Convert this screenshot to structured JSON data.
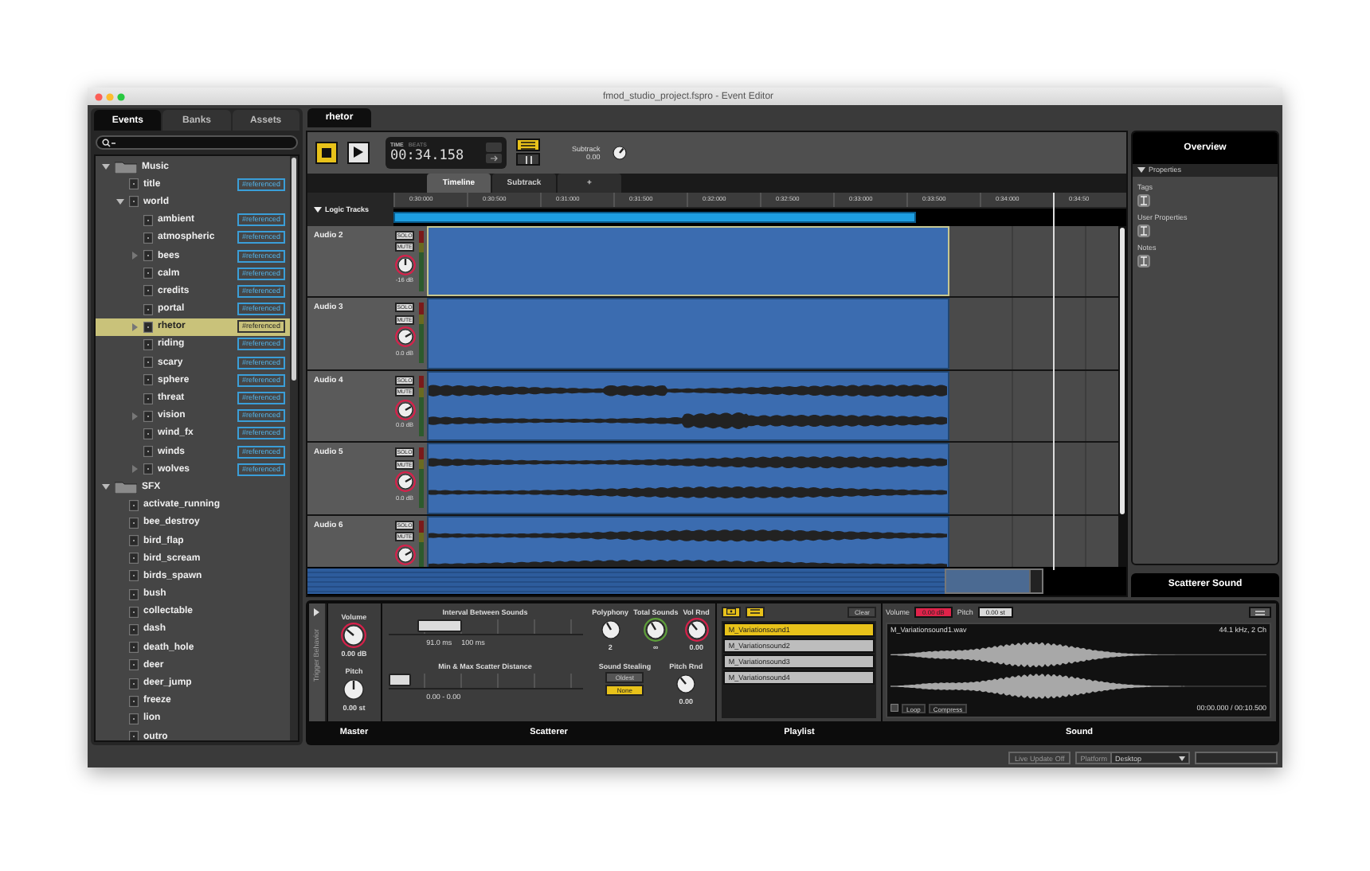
{
  "window": {
    "title": "fmod_studio_project.fspro - Event Editor"
  },
  "browser": {
    "tabs": [
      {
        "label": "Events",
        "selected": true
      },
      {
        "label": "Banks",
        "selected": false
      },
      {
        "label": "Assets",
        "selected": false
      }
    ],
    "tree": [
      {
        "label": "Music",
        "kind": "folder",
        "expanded": true,
        "selected": false,
        "children": [
          {
            "label": "title",
            "kind": "event",
            "badge": "#referenced",
            "selected": false
          },
          {
            "label": "world",
            "kind": "event",
            "expanded": true,
            "selected": false,
            "children": [
              {
                "label": "ambient",
                "kind": "event",
                "badge": "#referenced",
                "selected": false
              },
              {
                "label": "atmospheric",
                "kind": "event",
                "badge": "#referenced",
                "selected": false
              },
              {
                "label": "bees",
                "kind": "event",
                "expanded": false,
                "badge": "#referenced",
                "selected": false
              },
              {
                "label": "calm",
                "kind": "event",
                "badge": "#referenced",
                "selected": false
              },
              {
                "label": "credits",
                "kind": "event",
                "badge": "#referenced",
                "selected": false
              },
              {
                "label": "portal",
                "kind": "event",
                "badge": "#referenced",
                "selected": false
              },
              {
                "label": "rhetor",
                "kind": "event",
                "expanded": false,
                "badge": "#referenced",
                "selected": true
              },
              {
                "label": "riding",
                "kind": "event",
                "badge": "#referenced",
                "selected": false
              },
              {
                "label": "scary",
                "kind": "event",
                "badge": "#referenced",
                "selected": false
              },
              {
                "label": "sphere",
                "kind": "event",
                "badge": "#referenced",
                "selected": false
              },
              {
                "label": "threat",
                "kind": "event",
                "badge": "#referenced",
                "selected": false
              },
              {
                "label": "vision",
                "kind": "event",
                "expanded": false,
                "badge": "#referenced",
                "selected": false
              },
              {
                "label": "wind_fx",
                "kind": "event",
                "badge": "#referenced",
                "selected": false
              },
              {
                "label": "winds",
                "kind": "event",
                "badge": "#referenced",
                "selected": false
              },
              {
                "label": "wolves",
                "kind": "event",
                "expanded": false,
                "badge": "#referenced",
                "selected": false
              }
            ]
          }
        ]
      },
      {
        "label": "SFX",
        "kind": "folder",
        "expanded": true,
        "selected": false,
        "children": [
          {
            "label": "activate_running",
            "kind": "event",
            "selected": false
          },
          {
            "label": "bee_destroy",
            "kind": "event",
            "selected": false
          },
          {
            "label": "bird_flap",
            "kind": "event",
            "selected": false
          },
          {
            "label": "bird_scream",
            "kind": "event",
            "selected": false
          },
          {
            "label": "birds_spawn",
            "kind": "event",
            "selected": false
          },
          {
            "label": "bush",
            "kind": "event",
            "selected": false
          },
          {
            "label": "collectable",
            "kind": "event",
            "selected": false
          },
          {
            "label": "dash",
            "kind": "event",
            "selected": false
          },
          {
            "label": "death_hole",
            "kind": "event",
            "selected": false
          },
          {
            "label": "deer",
            "kind": "event",
            "selected": false
          },
          {
            "label": "deer_jump",
            "kind": "event",
            "selected": false
          },
          {
            "label": "freeze",
            "kind": "event",
            "selected": false
          },
          {
            "label": "lion",
            "kind": "event",
            "selected": false
          },
          {
            "label": "outro",
            "kind": "event",
            "selected": false
          }
        ]
      }
    ]
  },
  "editor": {
    "tab": "rhetor",
    "transport": {
      "time_label": "TIME",
      "beats_label": "BEATS",
      "time": "00:34.158",
      "subtrack_label": "Subtrack",
      "subtrack_value": "0.00"
    },
    "view_tabs": [
      {
        "label": "Timeline",
        "selected": true
      },
      {
        "label": "Subtrack",
        "selected": false
      },
      {
        "label": "+",
        "selected": false
      }
    ],
    "logic_tracks": "Logic Tracks",
    "ruler": [
      "0:30:000",
      "0:30:500",
      "0:31:000",
      "0:31:500",
      "0:32:000",
      "0:32:500",
      "0:33:000",
      "0:33:500",
      "0:34:000",
      "0:34:50"
    ],
    "tracks": [
      {
        "name": "Audio 2",
        "solo": "SOLO",
        "mute": "MUTE",
        "volume": "-16 dB",
        "kind": "solid",
        "selected": true
      },
      {
        "name": "Audio 3",
        "solo": "SOLO",
        "mute": "MUTE",
        "volume": "0.0 dB",
        "kind": "solid",
        "selected": false
      },
      {
        "name": "Audio 4",
        "solo": "SOLO",
        "mute": "MUTE",
        "volume": "0.0 dB",
        "kind": "wave",
        "selected": false
      },
      {
        "name": "Audio 5",
        "solo": "SOLO",
        "mute": "MUTE",
        "volume": "0.0 dB",
        "kind": "wave",
        "selected": false
      },
      {
        "name": "Audio 6",
        "solo": "SOLO",
        "mute": "MUTE",
        "kind": "wave",
        "selected": false
      }
    ]
  },
  "overview": {
    "title": "Overview",
    "section": "Properties",
    "fields": [
      "Tags",
      "User Properties",
      "Notes"
    ]
  },
  "scatterer_sound": {
    "title": "Scatterer Sound"
  },
  "deck": {
    "trigger": "Trigger Behavior",
    "master": {
      "label": "Master",
      "volume_label": "Volume",
      "volume": "0.00 dB",
      "pitch_label": "Pitch",
      "pitch": "0.00 st"
    },
    "scatterer": {
      "label": "Scatterer",
      "interval": {
        "label": "Interval Between Sounds",
        "level": 0.15,
        "min": "91.0 ms",
        "max": "100 ms"
      },
      "distance": {
        "label": "Min & Max Scatter Distance",
        "level": 0,
        "value": "0.00 - 0.00"
      },
      "polyphony_label": "Polyphony",
      "polyphony": "2",
      "total_label": "Total Sounds",
      "total": "∞",
      "vol_rnd_label": "Vol Rnd",
      "vol_rnd": "0.00",
      "stealing_label": "Sound Stealing",
      "stealing": [
        {
          "label": "Oldest",
          "selected": false
        },
        {
          "label": "None",
          "selected": true
        }
      ],
      "pitch_rnd_label": "Pitch Rnd",
      "pitch_rnd": "0.00"
    },
    "playlist": {
      "label": "Playlist",
      "clear": "Clear",
      "items": [
        {
          "label": "M_Variationsound1",
          "selected": true
        },
        {
          "label": "M_Variationsound2",
          "selected": false
        },
        {
          "label": "M_Variationsound3",
          "selected": false
        },
        {
          "label": "M_Variationsound4",
          "selected": false
        }
      ]
    },
    "sound": {
      "label": "Sound",
      "volume_label": "Volume",
      "volume": "0.00 dB",
      "pitch_label": "Pitch",
      "pitch": "0.00 st",
      "file": "M_Variationsound1.wav",
      "format": "44.1 kHz, 2 Ch",
      "loop": "Loop",
      "compress": "Compress",
      "time": "00:00.000 / 00:10.500"
    }
  },
  "status_bar": {
    "live_update": "Live Update Off",
    "platform_label": "Platform",
    "platform": "Desktop"
  }
}
